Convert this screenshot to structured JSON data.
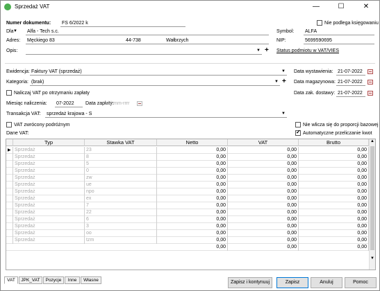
{
  "window": {
    "title": "Sprzedaż VAT",
    "minimize": "—",
    "maximize": "☐",
    "close": "✕"
  },
  "form": {
    "doc_number_label": "Numer dokumentu:",
    "doc_number": "FS 6/2022 k",
    "not_booked_label": "Nie podlega księgowaniu",
    "dla_label": "Dla",
    "client_name": "Alfa - Tech s.c.",
    "symbol_label": "Symbol:",
    "symbol": "ALFA",
    "adres_label": "Adres:",
    "street": "Męckiego",
    "house_no": "83",
    "postal": "44-738",
    "city": "Wałbrzych",
    "nip_label": "NIP:",
    "nip": "5699590695",
    "opis_label": "Opis:",
    "status_link": "Status podmiotu w VAT/VIES",
    "ewidencja_label": "Ewidencja:",
    "ewidencja": "Faktury VAT (sprzedaż)",
    "data_wyst_label": "Data wystawienia:",
    "data_wyst": "21-07-2022",
    "kategoria_label": "Kategoria:",
    "kategoria": "(brak)",
    "data_mag_label": "Data magazynowa:",
    "data_mag": "21-07-2022",
    "nalicz_label": "Naliczaj VAT po otrzymaniu zapłaty",
    "data_dost_label": "Data zak. dostawy:",
    "data_dost": "21-07-2022",
    "miesiac_label": "Miesiąc naliczenia:",
    "miesiac": "07-2022",
    "data_zaplaty_label": "Data zapłaty:",
    "data_zaplaty_placeholder": "dd-mm-rrrr",
    "transakcja_label": "Transakcja VAT:",
    "transakcja": "sprzedaż krajowa - S",
    "vat_zwrocony_label": "VAT zwrócony podróżnym",
    "nie_wlicza_label": "Nie wlicza się do proporcji bazowej",
    "dane_vat_label": "Dane VAT:",
    "auto_kwot_label": "Automatyczne przeliczanie kwot"
  },
  "grid": {
    "columns": [
      "Typ",
      "Stawka VAT",
      "Netto",
      "VAT",
      "Brutto"
    ],
    "rows": [
      {
        "typ": "Sprzedaż",
        "stawka": "23",
        "netto": "0,00",
        "vat": "0,00",
        "brutto": "0,00"
      },
      {
        "typ": "Sprzedaż",
        "stawka": "8",
        "netto": "0,00",
        "vat": "0,00",
        "brutto": "0,00"
      },
      {
        "typ": "Sprzedaż",
        "stawka": "5",
        "netto": "0,00",
        "vat": "0,00",
        "brutto": "0,00"
      },
      {
        "typ": "Sprzedaż",
        "stawka": "0",
        "netto": "0,00",
        "vat": "0,00",
        "brutto": "0,00"
      },
      {
        "typ": "Sprzedaż",
        "stawka": "zw",
        "netto": "0,00",
        "vat": "0,00",
        "brutto": "0,00"
      },
      {
        "typ": "Sprzedaż",
        "stawka": "ue",
        "netto": "0,00",
        "vat": "0,00",
        "brutto": "0,00"
      },
      {
        "typ": "Sprzedaż",
        "stawka": "npo",
        "netto": "0,00",
        "vat": "0,00",
        "brutto": "0,00"
      },
      {
        "typ": "Sprzedaż",
        "stawka": "ex",
        "netto": "0,00",
        "vat": "0,00",
        "brutto": "0,00"
      },
      {
        "typ": "Sprzedaż",
        "stawka": "7",
        "netto": "0,00",
        "vat": "0,00",
        "brutto": "0,00"
      },
      {
        "typ": "Sprzedaż",
        "stawka": "22",
        "netto": "0,00",
        "vat": "0,00",
        "brutto": "0,00"
      },
      {
        "typ": "Sprzedaż",
        "stawka": "6",
        "netto": "0,00",
        "vat": "0,00",
        "brutto": "0,00"
      },
      {
        "typ": "Sprzedaż",
        "stawka": "3",
        "netto": "0,00",
        "vat": "0,00",
        "brutto": "0,00"
      },
      {
        "typ": "Sprzedaż",
        "stawka": "oo",
        "netto": "0,00",
        "vat": "0,00",
        "brutto": "0,00"
      },
      {
        "typ": "Sprzedaż",
        "stawka": "tzm",
        "netto": "0,00",
        "vat": "0,00",
        "brutto": "0,00"
      }
    ],
    "totals": {
      "netto": "0,00",
      "vat": "0,00",
      "brutto": "0,00"
    }
  },
  "tabs": [
    "VAT",
    "JPK_VAT",
    "Pozycje",
    "Inne",
    "Własne"
  ],
  "buttons": {
    "save_continue": "Zapisz i kontynuuj",
    "save": "Zapisz",
    "cancel": "Anuluj",
    "help": "Pomoc"
  }
}
